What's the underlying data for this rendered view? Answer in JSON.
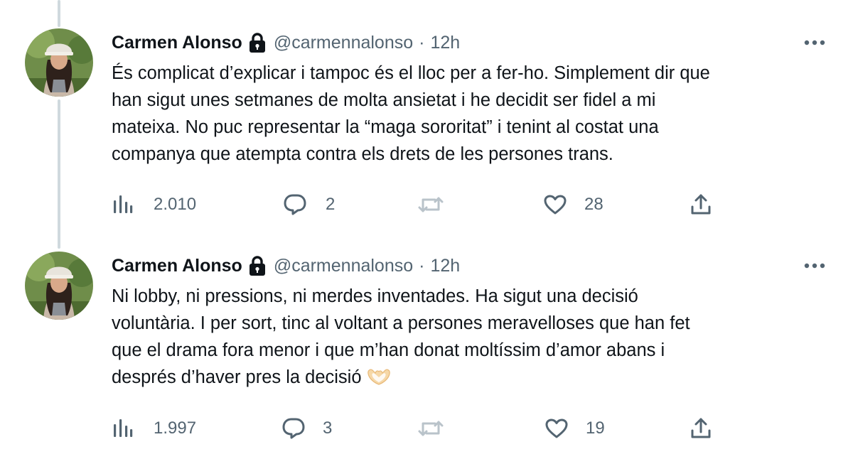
{
  "tweets": [
    {
      "author_name": "Carmen Alonso",
      "handle": "@carmennalonso",
      "separator": "·",
      "time": "12h",
      "text_lines": [
        "És complicat d’explicar i tampoc és el lloc per a fer-ho. Simplement dir que",
        "han sigut unes setmanes de molta ansietat i he decidit ser fidel a mi",
        "mateixa. No puc representar la “maga sororitat” i tenint al costat una",
        "companya que atempta contra els drets de les persones trans."
      ],
      "views": "2.010",
      "replies": "2",
      "retweets": "",
      "likes": "28"
    },
    {
      "author_name": "Carmen Alonso",
      "handle": "@carmennalonso",
      "separator": "·",
      "time": "12h",
      "text_lines": [
        "Ni lobby, ni pressions, ni merdes inventades. Ha sigut una decisió",
        "voluntària. I per sort, tinc al voltant a persones meravelloses que han fet",
        "que el drama fora menor i que m’han donat moltíssim d’amor abans i",
        "després d’haver pres la decisió"
      ],
      "trailing_emoji": "heart-hands-icon",
      "views": "1.997",
      "replies": "3",
      "retweets": "",
      "likes": "19"
    }
  ],
  "colors": {
    "text": "#0f1419",
    "secondary": "#536471",
    "thread_line": "#cfd9de",
    "background": "#ffffff"
  }
}
